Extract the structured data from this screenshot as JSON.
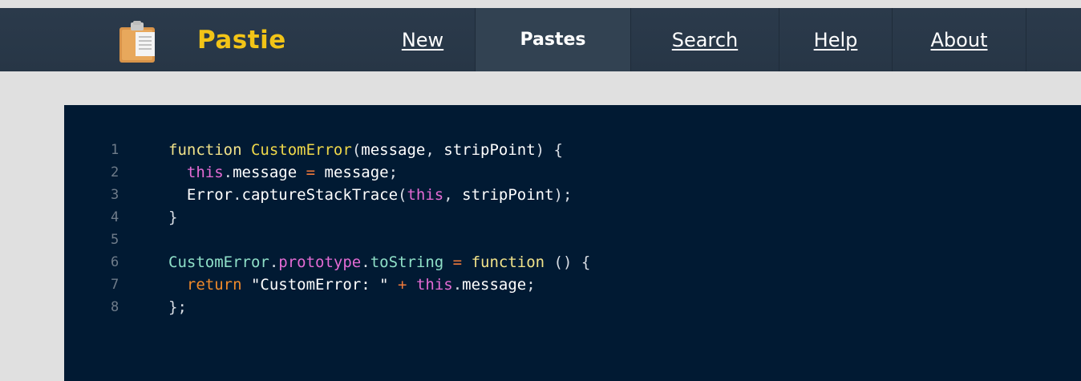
{
  "header": {
    "logo_text": "Pastie",
    "nav": [
      {
        "label": "New",
        "active": false
      },
      {
        "label": "Pastes",
        "active": true
      },
      {
        "label": "Search",
        "active": false
      },
      {
        "label": "Help",
        "active": false
      },
      {
        "label": "About",
        "active": false
      }
    ]
  },
  "code": {
    "line_numbers": [
      "1",
      "2",
      "3",
      "4",
      "5",
      "6",
      "7",
      "8"
    ],
    "lines": [
      "function CustomError(message, stripPoint) {",
      "  this.message = message;",
      "  Error.captureStackTrace(this, stripPoint);",
      "}",
      "",
      "CustomError.prototype.toString = function () {",
      "  return \"CustomError: \" + this.message;",
      "};"
    ]
  },
  "colors": {
    "header_bg": "#2b3a4b",
    "logo": "#f2c417",
    "code_bg": "#011a33",
    "keyword": "#f2e38a",
    "this": "#e46bd4",
    "return": "#f08a2a",
    "class": "#8fe0c8"
  }
}
